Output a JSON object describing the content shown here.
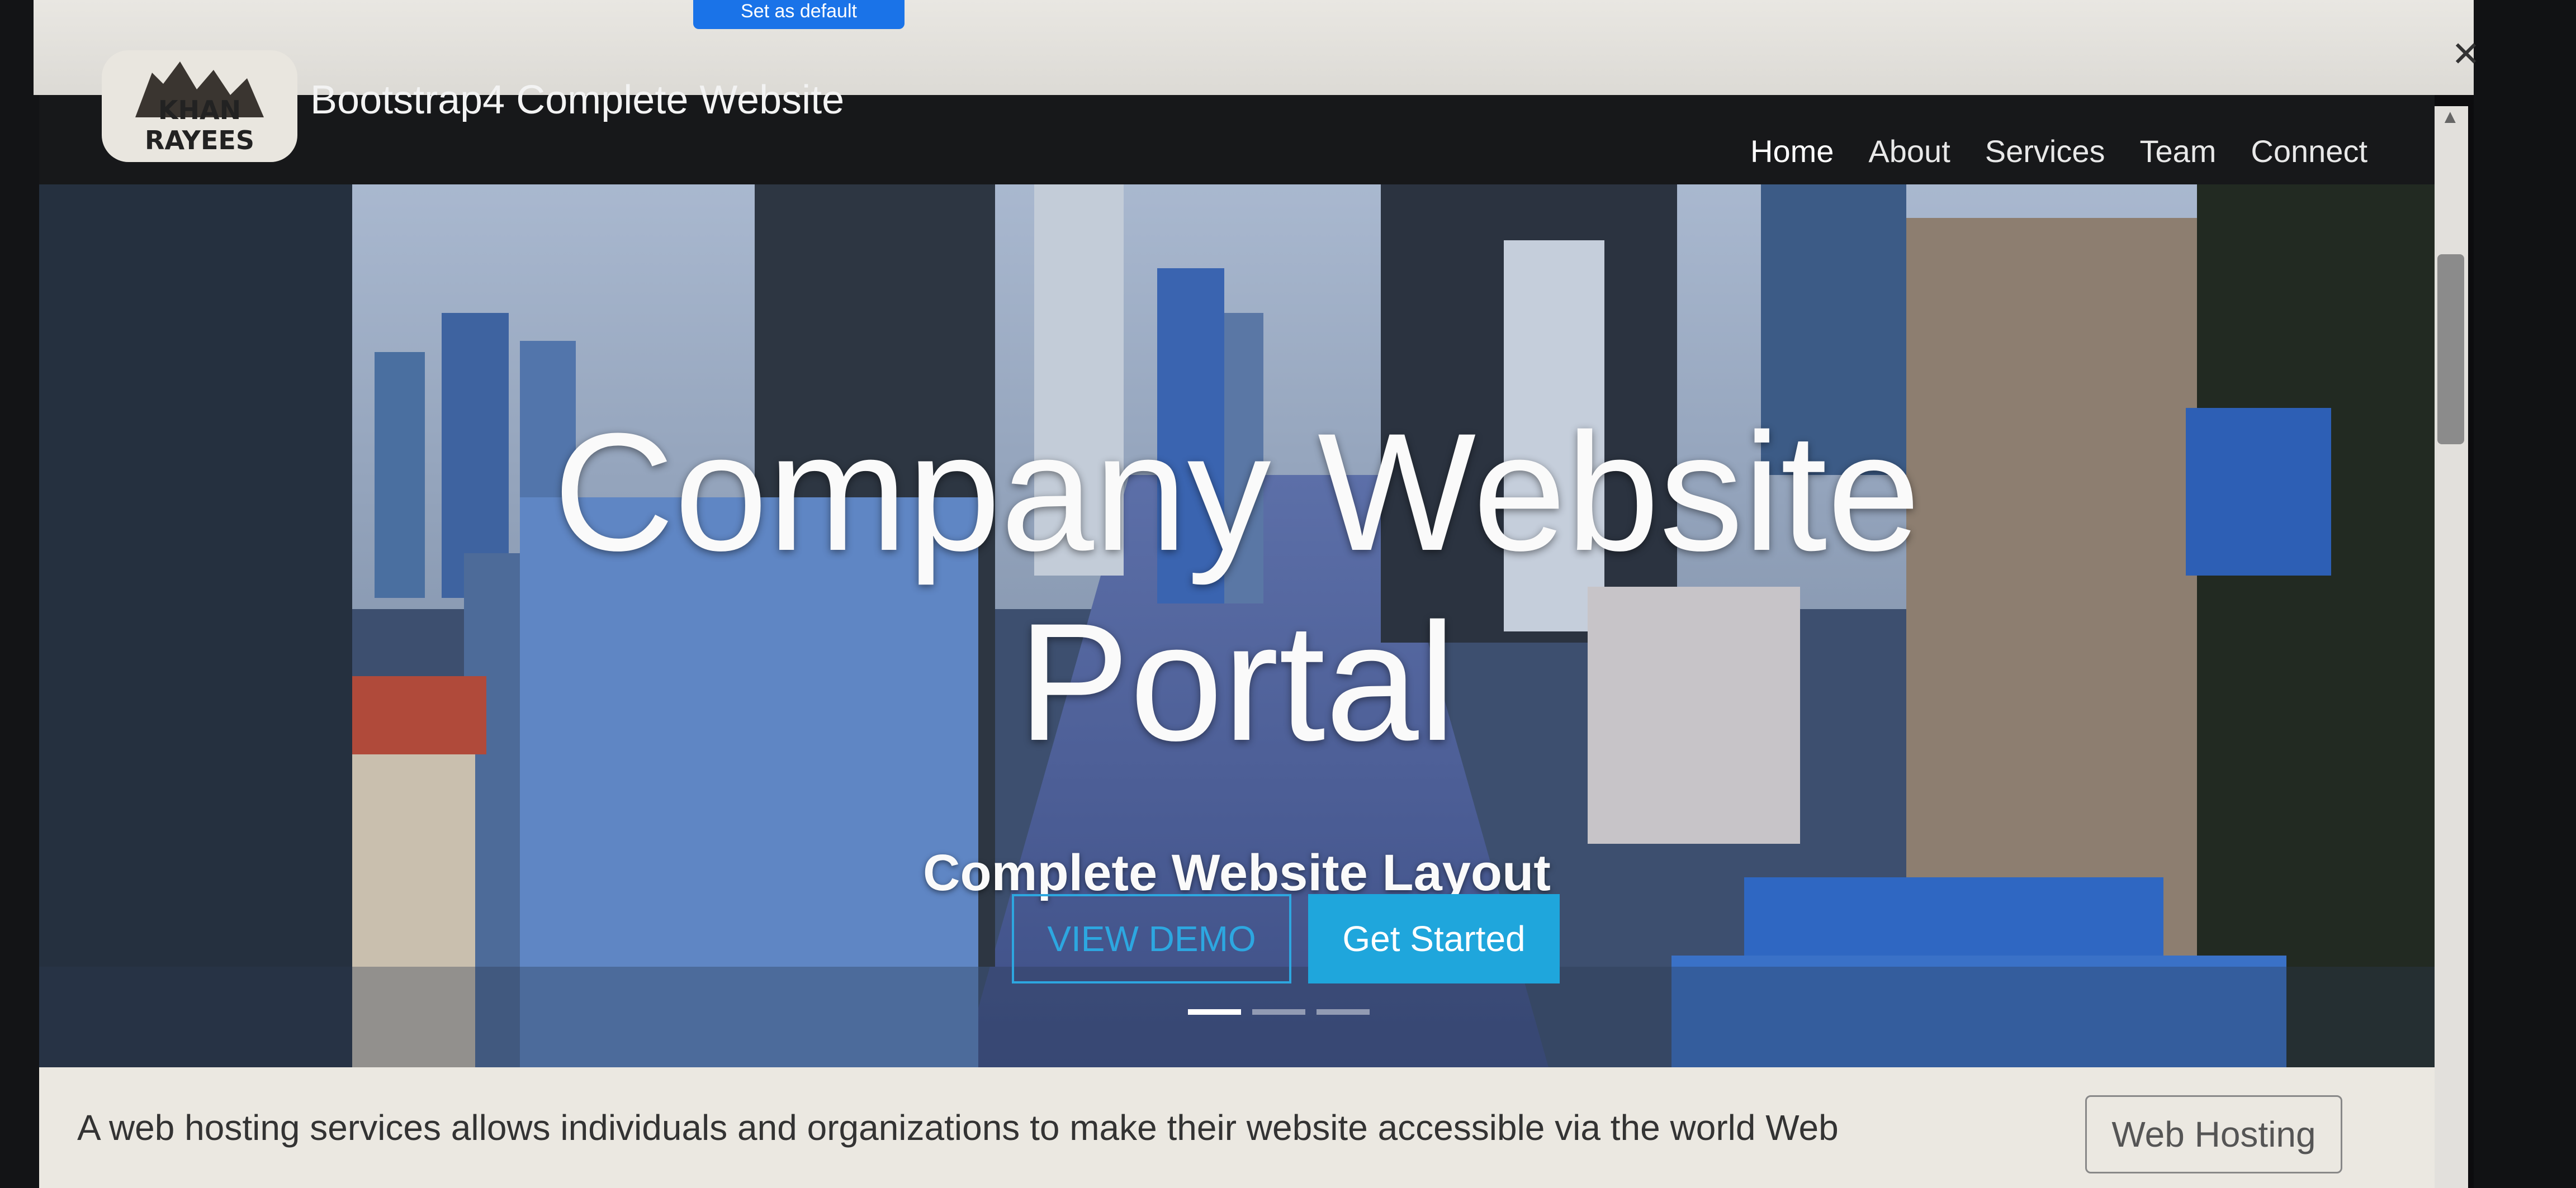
{
  "browser_bar": {
    "default_button_label": "Set as default",
    "close_glyph": "✕"
  },
  "navbar": {
    "logo_text": "KHAN RAYEES",
    "brand": "Bootstrap4 Complete Website",
    "items": [
      {
        "label": "Home"
      },
      {
        "label": "About"
      },
      {
        "label": "Services"
      },
      {
        "label": "Team"
      },
      {
        "label": "Connect"
      }
    ]
  },
  "hero": {
    "title_line1": "Company Website",
    "title_line2": "Portal",
    "subtitle": "Complete Website Layout",
    "demo_button": "VIEW DEMO",
    "start_button": "Get Started",
    "active_slide": 1,
    "slide_count": 3
  },
  "content": {
    "paragraph": "A web hosting services allows individuals and organizations to make their website accessible via the world Web",
    "hosting_button": "Web Hosting"
  },
  "colors": {
    "navbar_bg": "#17181a",
    "accent_blue": "#1fa6dc",
    "content_bg": "#ebe8e1"
  }
}
